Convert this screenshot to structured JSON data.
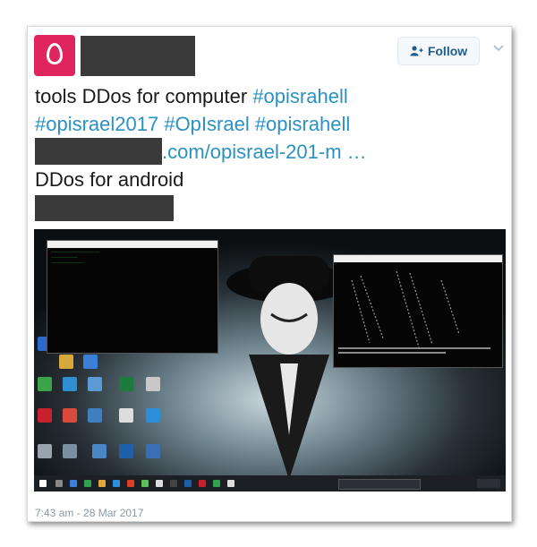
{
  "tweet": {
    "follow_label": "Follow",
    "line1_text": "tools DDos for computer ",
    "line1_tag": "#opisrahell",
    "line2_tags": "#opisrael2017 #OpIsrael #opisrahell",
    "line3_link": ".com/opisrael-201-m …",
    "line4_text": "DDos for android",
    "timestamp": "7:43 am - 28 Mar 2017"
  },
  "colors": {
    "avatar": "#e0245e",
    "hashtag": "#2b91c2",
    "follow_text": "#1d5e8e",
    "redaction": "#3a3a3a"
  },
  "icons": {
    "follow": "person-plus-icon",
    "caret": "chevron-down-icon",
    "avatar": "egg-avatar-icon"
  }
}
